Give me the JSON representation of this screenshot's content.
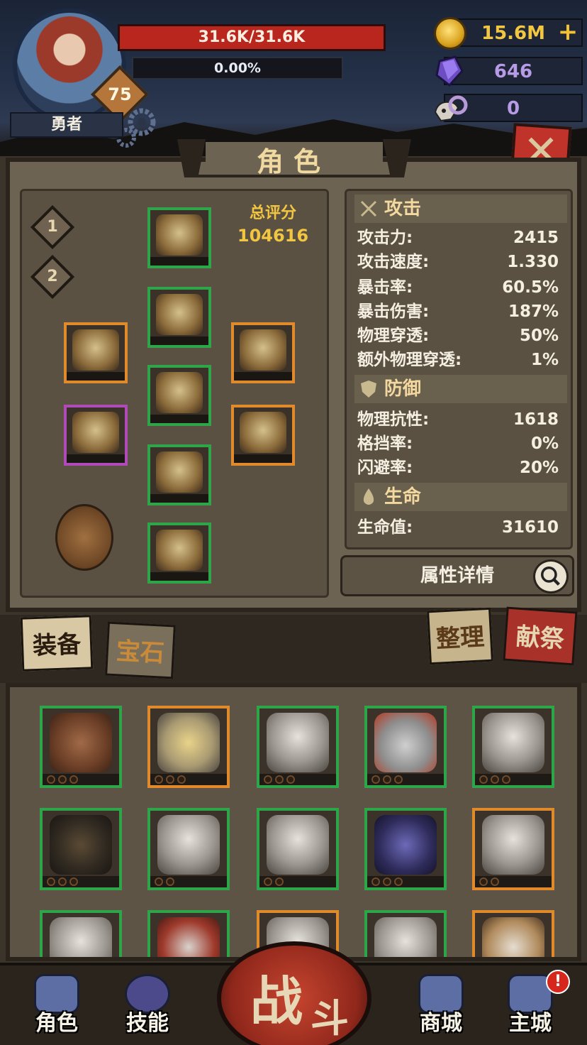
{
  "player": {
    "name": "勇者",
    "level": "75",
    "hp_text": "31.6K/31.6K",
    "xp_text": "0.00%",
    "xp_progress": 0.0
  },
  "currency": {
    "gold": "15.6M",
    "gems": "646",
    "souls": "0"
  },
  "panel": {
    "title": "角色",
    "loadouts": [
      "1",
      "2"
    ],
    "total_score_label": "总评分",
    "total_score_value": "104616"
  },
  "stats": {
    "attack_header": "攻击",
    "attack": [
      {
        "label": "攻击力:",
        "value": "2415"
      },
      {
        "label": "攻击速度:",
        "value": "1.330"
      },
      {
        "label": "暴击率:",
        "value": "60.5%"
      },
      {
        "label": "暴击伤害:",
        "value": "187%"
      },
      {
        "label": "物理穿透:",
        "value": "50%"
      },
      {
        "label": "额外物理穿透:",
        "value": "1%"
      }
    ],
    "defense_header": "防御",
    "defense": [
      {
        "label": "物理抗性:",
        "value": "1618"
      },
      {
        "label": "格挡率:",
        "value": "0%"
      },
      {
        "label": "闪避率:",
        "value": "20%"
      }
    ],
    "life_header": "生命",
    "life": [
      {
        "label": "生命值:",
        "value": "31610"
      }
    ],
    "details_button": "属性详情"
  },
  "tabs": {
    "equipment": "装备",
    "gems": "宝石",
    "sort": "整理",
    "sacrifice": "献祭"
  },
  "nav": {
    "character": "角色",
    "skills": "技能",
    "battle_a": "战",
    "battle_b": "斗",
    "shop": "商城",
    "main_city": "主城",
    "alert": "!"
  },
  "colors": {
    "hp": "#b8261d",
    "gold_text": "#f2c640",
    "gem_text": "#b79be6",
    "rarity_green": "#2fa54a",
    "rarity_orange": "#e08a2c",
    "rarity_purple": "#b04ab8"
  }
}
